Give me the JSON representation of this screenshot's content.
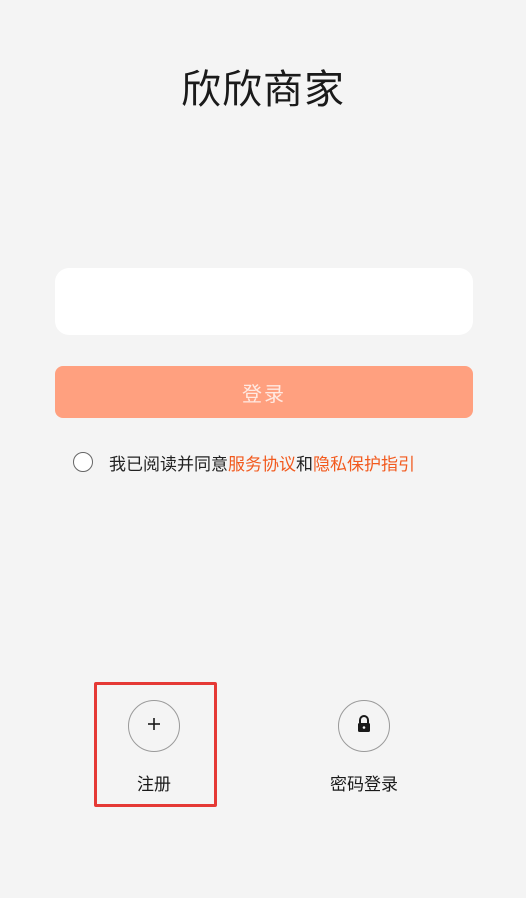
{
  "app": {
    "title": "欣欣商家"
  },
  "form": {
    "phone_value": "",
    "phone_placeholder": "",
    "login_label": "登录"
  },
  "agreement": {
    "prefix": "我已阅读并同意",
    "service_link": "服务协议",
    "joiner": "和",
    "privacy_link": "隐私保护指引",
    "checked": false
  },
  "quick_actions": {
    "register": {
      "icon": "plus-icon",
      "label": "注册"
    },
    "password_login": {
      "icon": "lock-icon",
      "label": "密码登录"
    }
  },
  "colors": {
    "background": "#f4f4f4",
    "primary_disabled": "#ffa07f",
    "link": "#f25a1e",
    "highlight_box": "#e53935"
  }
}
